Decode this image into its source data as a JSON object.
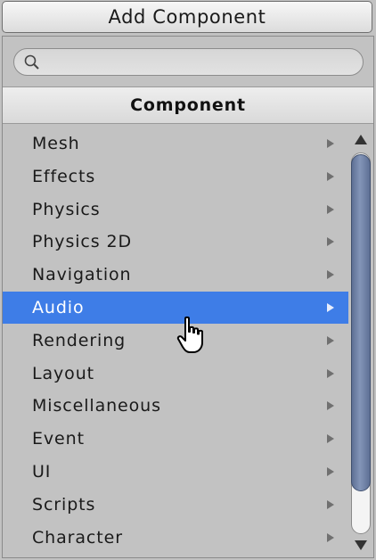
{
  "add_button": {
    "label": "Add Component"
  },
  "search": {
    "value": "",
    "placeholder": ""
  },
  "header": {
    "title": "Component"
  },
  "menu": {
    "items": [
      {
        "label": "Mesh",
        "has_submenu": true,
        "selected": false
      },
      {
        "label": "Effects",
        "has_submenu": true,
        "selected": false
      },
      {
        "label": "Physics",
        "has_submenu": true,
        "selected": false
      },
      {
        "label": "Physics 2D",
        "has_submenu": true,
        "selected": false
      },
      {
        "label": "Navigation",
        "has_submenu": true,
        "selected": false
      },
      {
        "label": "Audio",
        "has_submenu": true,
        "selected": true
      },
      {
        "label": "Rendering",
        "has_submenu": true,
        "selected": false
      },
      {
        "label": "Layout",
        "has_submenu": true,
        "selected": false
      },
      {
        "label": "Miscellaneous",
        "has_submenu": true,
        "selected": false
      },
      {
        "label": "Event",
        "has_submenu": true,
        "selected": false
      },
      {
        "label": "UI",
        "has_submenu": true,
        "selected": false
      },
      {
        "label": "Scripts",
        "has_submenu": true,
        "selected": false
      },
      {
        "label": "Character",
        "has_submenu": true,
        "selected": false
      }
    ]
  },
  "colors": {
    "selection": "#3e7de7",
    "panel_background": "#c2c2c2",
    "scroll_thumb": "#6f81a6"
  },
  "icons": {
    "search": "search-icon",
    "submenu": "chevron-right-icon",
    "scroll_up": "arrow-up-icon",
    "scroll_down": "arrow-down-icon",
    "cursor": "hand-pointer-icon"
  }
}
